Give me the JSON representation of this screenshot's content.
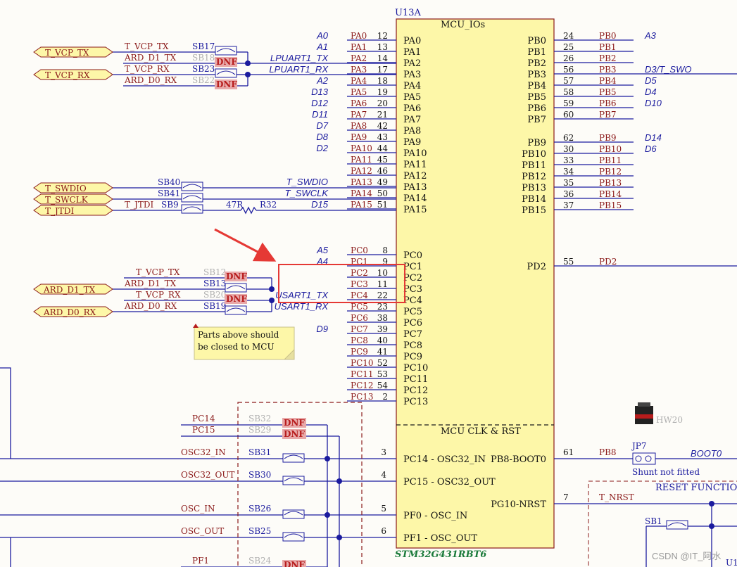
{
  "mcu": {
    "ref": "U13A",
    "title": "MCU_IOs",
    "clk_title": "MCU CLK & RST",
    "part_number": "STM32G431RBT6"
  },
  "left_pins": [
    {
      "num": "12",
      "port": "PA0",
      "name": "PA0",
      "alias": "A0"
    },
    {
      "num": "13",
      "port": "PA1",
      "name": "PA1",
      "alias": "A1"
    },
    {
      "num": "14",
      "port": "PA2",
      "name": "PA2",
      "alias": "LPUART1_TX"
    },
    {
      "num": "17",
      "port": "PA3",
      "name": "PA3",
      "alias": "LPUART1_RX"
    },
    {
      "num": "18",
      "port": "PA4",
      "name": "PA4",
      "alias": "A2"
    },
    {
      "num": "19",
      "port": "PA5",
      "name": "PA5",
      "alias": "D13"
    },
    {
      "num": "20",
      "port": "PA6",
      "name": "PA6",
      "alias": "D12"
    },
    {
      "num": "21",
      "port": "PA7",
      "name": "PA7",
      "alias": "D11"
    },
    {
      "num": "42",
      "port": "PA8",
      "name": "PA8",
      "alias": "D7"
    },
    {
      "num": "43",
      "port": "PA9",
      "name": "PA9",
      "alias": "D8"
    },
    {
      "num": "44",
      "port": "PA10",
      "name": "PA10",
      "alias": "D2"
    },
    {
      "num": "45",
      "port": "PA11",
      "name": "PA11",
      "alias": ""
    },
    {
      "num": "46",
      "port": "PA12",
      "name": "PA12",
      "alias": ""
    },
    {
      "num": "49",
      "port": "PA13",
      "name": "PA13",
      "alias": "T_SWDIO"
    },
    {
      "num": "50",
      "port": "PA14",
      "name": "PA14",
      "alias": "T_SWCLK"
    },
    {
      "num": "51",
      "port": "PA15",
      "name": "PA15",
      "alias": "D15"
    },
    {
      "num": "8",
      "port": "PC0",
      "name": "PC0",
      "alias": "A5"
    },
    {
      "num": "9",
      "port": "PC1",
      "name": "PC1",
      "alias": "A4"
    },
    {
      "num": "10",
      "port": "PC2",
      "name": "PC2",
      "alias": ""
    },
    {
      "num": "11",
      "port": "PC3",
      "name": "PC3",
      "alias": ""
    },
    {
      "num": "22",
      "port": "PC4",
      "name": "PC4",
      "alias": "USART1_TX"
    },
    {
      "num": "23",
      "port": "PC5",
      "name": "PC5",
      "alias": "USART1_RX"
    },
    {
      "num": "38",
      "port": "PC6",
      "name": "PC6",
      "alias": ""
    },
    {
      "num": "39",
      "port": "PC7",
      "name": "PC7",
      "alias": "D9"
    },
    {
      "num": "40",
      "port": "PC8",
      "name": "PC8",
      "alias": ""
    },
    {
      "num": "41",
      "port": "PC9",
      "name": "PC9",
      "alias": ""
    },
    {
      "num": "52",
      "port": "PC10",
      "name": "PC10",
      "alias": ""
    },
    {
      "num": "53",
      "port": "PC11",
      "name": "PC11",
      "alias": ""
    },
    {
      "num": "54",
      "port": "PC12",
      "name": "PC12",
      "alias": ""
    },
    {
      "num": "2",
      "port": "PC13",
      "name": "PC13",
      "alias": ""
    }
  ],
  "right_pins": [
    {
      "num": "24",
      "port": "PB0",
      "name": "PB0",
      "alias": "A3"
    },
    {
      "num": "25",
      "port": "PB1",
      "name": "PB1",
      "alias": ""
    },
    {
      "num": "26",
      "port": "PB2",
      "name": "PB2",
      "alias": ""
    },
    {
      "num": "56",
      "port": "PB3",
      "name": "PB3",
      "alias": "D3/T_SWO"
    },
    {
      "num": "57",
      "port": "PB4",
      "name": "PB4",
      "alias": "D5"
    },
    {
      "num": "58",
      "port": "PB5",
      "name": "PB5",
      "alias": "D4"
    },
    {
      "num": "59",
      "port": "PB6",
      "name": "PB6",
      "alias": "D10"
    },
    {
      "num": "60",
      "port": "PB7",
      "name": "PB7",
      "alias": ""
    },
    {
      "num": "62",
      "port": "PB9",
      "name": "PB9",
      "alias": "D14"
    },
    {
      "num": "30",
      "port": "PB10",
      "name": "PB10",
      "alias": "D6"
    },
    {
      "num": "33",
      "port": "PB11",
      "name": "PB11",
      "alias": ""
    },
    {
      "num": "34",
      "port": "PB12",
      "name": "PB12",
      "alias": ""
    },
    {
      "num": "35",
      "port": "PB13",
      "name": "PB13",
      "alias": ""
    },
    {
      "num": "36",
      "port": "PB14",
      "name": "PB14",
      "alias": ""
    },
    {
      "num": "37",
      "port": "PB15",
      "name": "PB15",
      "alias": ""
    },
    {
      "num": "55",
      "port": "PD2",
      "name": "PD2",
      "alias": ""
    }
  ],
  "clk_pins": [
    {
      "num": "3",
      "name": "PC14 - OSC32_IN",
      "net": "OSC32_IN",
      "sb": "SB31"
    },
    {
      "num": "4",
      "name": "PC15 - OSC32_OUT",
      "net": "OSC32_OUT",
      "sb": "SB30"
    },
    {
      "num": "5",
      "name": "PF0 - OSC_IN",
      "net": "OSC_IN",
      "sb": "SB26"
    },
    {
      "num": "6",
      "name": "PF1 - OSC_OUT",
      "net": "OSC_OUT",
      "sb": "SB25"
    }
  ],
  "clk_right": [
    {
      "num": "61",
      "name": "PB8-BOOT0",
      "port": "PB8"
    },
    {
      "num": "7",
      "name": "PG10-NRST",
      "port": "T_NRST"
    }
  ],
  "top_bridges": [
    {
      "net": "T_VCP_TX",
      "sb": "SB17",
      "dnf": false
    },
    {
      "net": "ARD_D1_TX",
      "sb": "SB18",
      "dnf": true
    },
    {
      "net": "T_VCP_RX",
      "sb": "SB23",
      "dnf": false
    },
    {
      "net": "ARD_D0_RX",
      "sb": "SB22",
      "dnf": true
    }
  ],
  "ports_top": [
    "T_VCP_TX",
    "T_VCP_RX"
  ],
  "swd": [
    {
      "port": "T_SWDIO",
      "sb": "SB40"
    },
    {
      "port": "T_SWCLK",
      "sb": "SB41"
    },
    {
      "port": "T_JTDI",
      "sb": "SB9",
      "net": "T_JTDI"
    }
  ],
  "resistor": {
    "ref": "R32",
    "value": "47R"
  },
  "usart_bridges": [
    {
      "net": "T_VCP_TX",
      "sb": "SB12",
      "dnf": true
    },
    {
      "net": "ARD_D1_TX",
      "sb": "SB13",
      "dnf": false
    },
    {
      "net": "T_VCP_RX",
      "sb": "SB20",
      "dnf": true
    },
    {
      "net": "ARD_D0_RX",
      "sb": "SB19",
      "dnf": false
    }
  ],
  "ports_mid": [
    "ARD_D1_TX",
    "ARD_D0_RX"
  ],
  "note": "Parts above should be closed to MCU",
  "osc_dnf": [
    {
      "net": "PC14",
      "sb": "SB32"
    },
    {
      "net": "PC15",
      "sb": "SB29"
    },
    {
      "net": "PF1",
      "sb": "SB24"
    }
  ],
  "dnf_label": "DNF",
  "boot": {
    "jp": "JP7",
    "net": "BOOT0",
    "shunt": "Shunt not fitted",
    "hw": "HW20"
  },
  "reset": {
    "title": "RESET FUNCTION",
    "sb": "SB1",
    "u": "U1"
  },
  "watermark": "CSDN @IT_阿水",
  "colors": {
    "wire": "#1b1b9e",
    "netlabel": "#8b1a1a",
    "box": "#fdf7a8",
    "highlight": "#e53935",
    "port": "#fdf7a8"
  }
}
